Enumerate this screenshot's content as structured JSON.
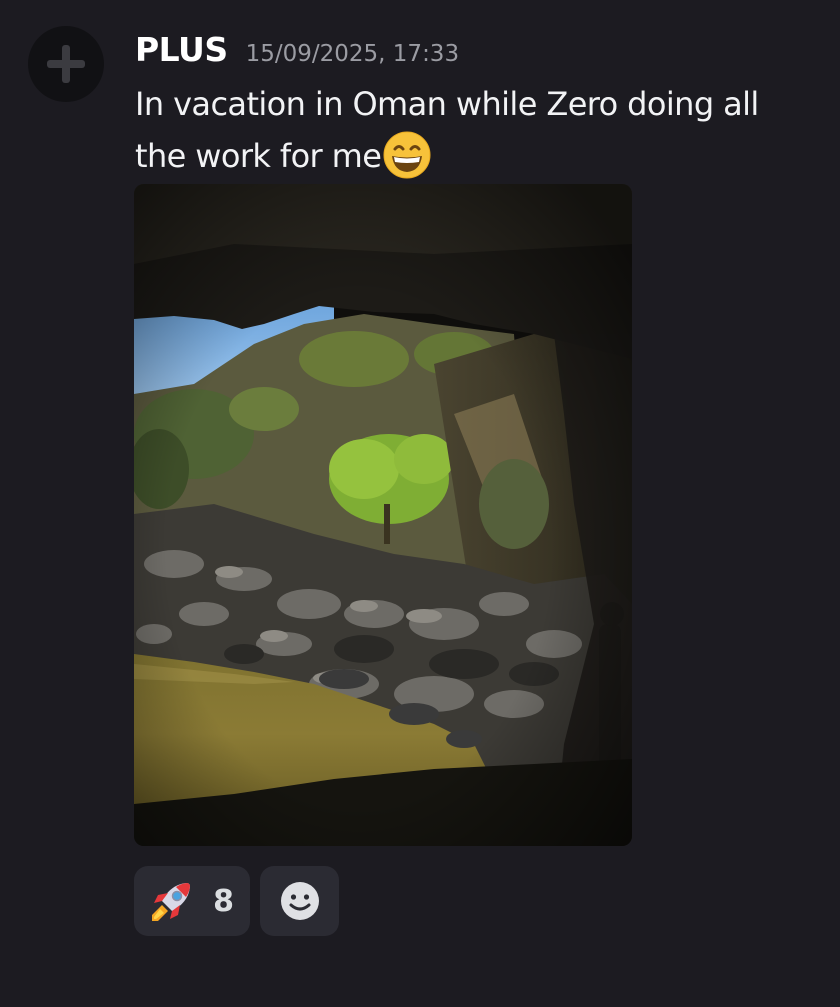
{
  "message": {
    "author": "PLUS",
    "timestamp": "15/09/2025, 17:33",
    "text": "In vacation in Oman while Zero doing all the work for me",
    "text_emoji": "grinning-squinting-face",
    "attachment": {
      "type": "image",
      "description_icon": "photo"
    }
  },
  "reactions": [
    {
      "emoji": "rocket",
      "count": "8"
    }
  ],
  "add_reaction": {
    "icon": "smiley-add-reaction"
  },
  "colors": {
    "background": "#1c1b21",
    "reaction_bg": "#2b2b33",
    "username": "#ffffff",
    "timestamp": "#9b9ca3"
  }
}
